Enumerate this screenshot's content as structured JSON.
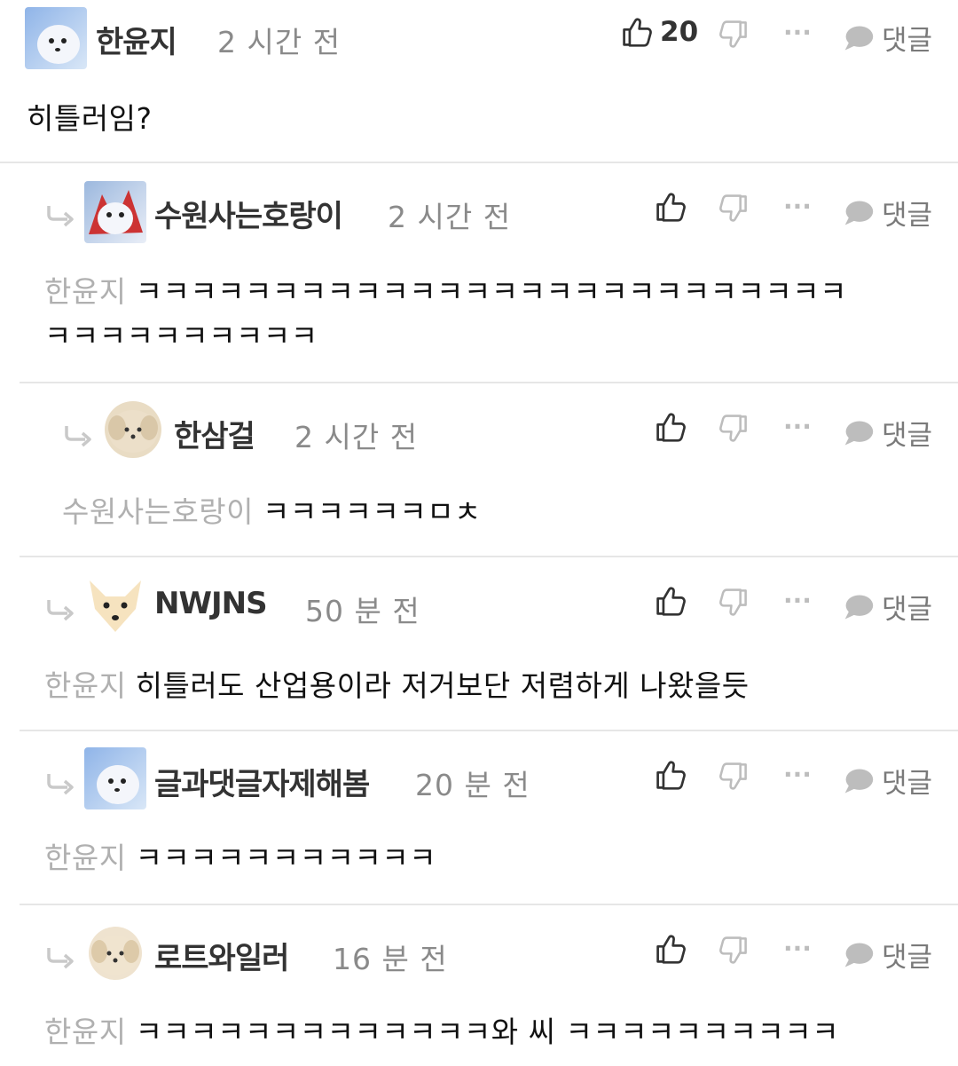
{
  "ui": {
    "reply_label": "댓글",
    "more_label": "···"
  },
  "comments": [
    {
      "author": "한윤지",
      "time": "2 시간 전",
      "likes": "20",
      "mention": "",
      "text": "히틀러임?",
      "text2": ""
    },
    {
      "author": "수원사는호랑이",
      "time": "2 시간 전",
      "likes": "",
      "mention": "한윤지",
      "text": "ㅋㅋㅋㅋㅋㅋㅋㅋㅋㅋㅋㅋㅋㅋㅋㅋㅋㅋㅋㅋㅋㅋㅋㅋㅋㅋ",
      "text2": "ㅋㅋㅋㅋㅋㅋㅋㅋㅋㅋ"
    },
    {
      "author": "한삼걸",
      "time": "2 시간 전",
      "likes": "",
      "mention": "수원사는호랑이",
      "text": "ㅋㅋㅋㅋㅋㅋㅁㅊ",
      "text2": ""
    },
    {
      "author": "NWJNS",
      "time": "50 분 전",
      "likes": "",
      "mention": "한윤지",
      "text": "히틀러도 산업용이라 저거보단 저렴하게 나왔을듯",
      "text2": ""
    },
    {
      "author": "글과댓글자제해봄",
      "time": "20 분 전",
      "likes": "",
      "mention": "한윤지",
      "text": "ㅋㅋㅋㅋㅋㅋㅋㅋㅋㅋㅋ",
      "text2": ""
    },
    {
      "author": "로트와일러",
      "time": "16 분 전",
      "likes": "",
      "mention": "한윤지",
      "text": "ㅋㅋㅋㅋㅋㅋㅋㅋㅋㅋㅋㅋㅋ와 씨 ㅋㅋㅋㅋㅋㅋㅋㅋㅋㅋ",
      "text2": ""
    }
  ],
  "icons": {
    "thumbs_up": "thumbs-up-icon",
    "thumbs_down": "thumbs-down-icon",
    "more": "more-dots-icon",
    "reply": "speech-bubble-icon",
    "reply_arrow": "reply-arrow-icon"
  },
  "colors": {
    "icon_dark": "#333333",
    "icon_light": "#bdbdbd",
    "bubble": "#bdbdbd",
    "separator": "#e6e6e6"
  }
}
